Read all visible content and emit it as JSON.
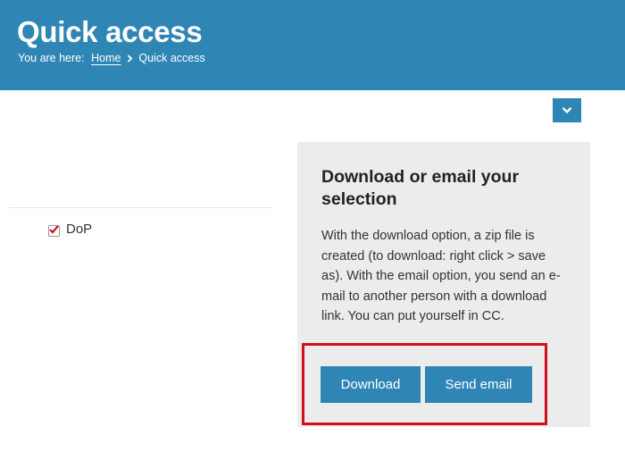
{
  "header": {
    "title": "Quick access",
    "breadcrumb": {
      "prefix": "You are here:",
      "home": "Home",
      "current": "Quick access"
    }
  },
  "selection": {
    "items": [
      {
        "label": "DoP",
        "checked": true
      }
    ]
  },
  "panel": {
    "title": "Download or email your selection",
    "description": "With the download option, a zip file is created (to download: right click > save as). With the email option, you send an e-mail to another person with a download link. You can put yourself in CC.",
    "download_label": "Download",
    "email_label": "Send email"
  },
  "icons": {
    "dropdown": "chevron-down-icon",
    "breadcrumb_separator": "chevron-right-icon",
    "checkmark": "checkmark-icon"
  },
  "colors": {
    "brand_blue": "#2f86b5",
    "panel_bg": "#ececec",
    "highlight_red": "#d0101b",
    "check_red": "#d0101b"
  }
}
